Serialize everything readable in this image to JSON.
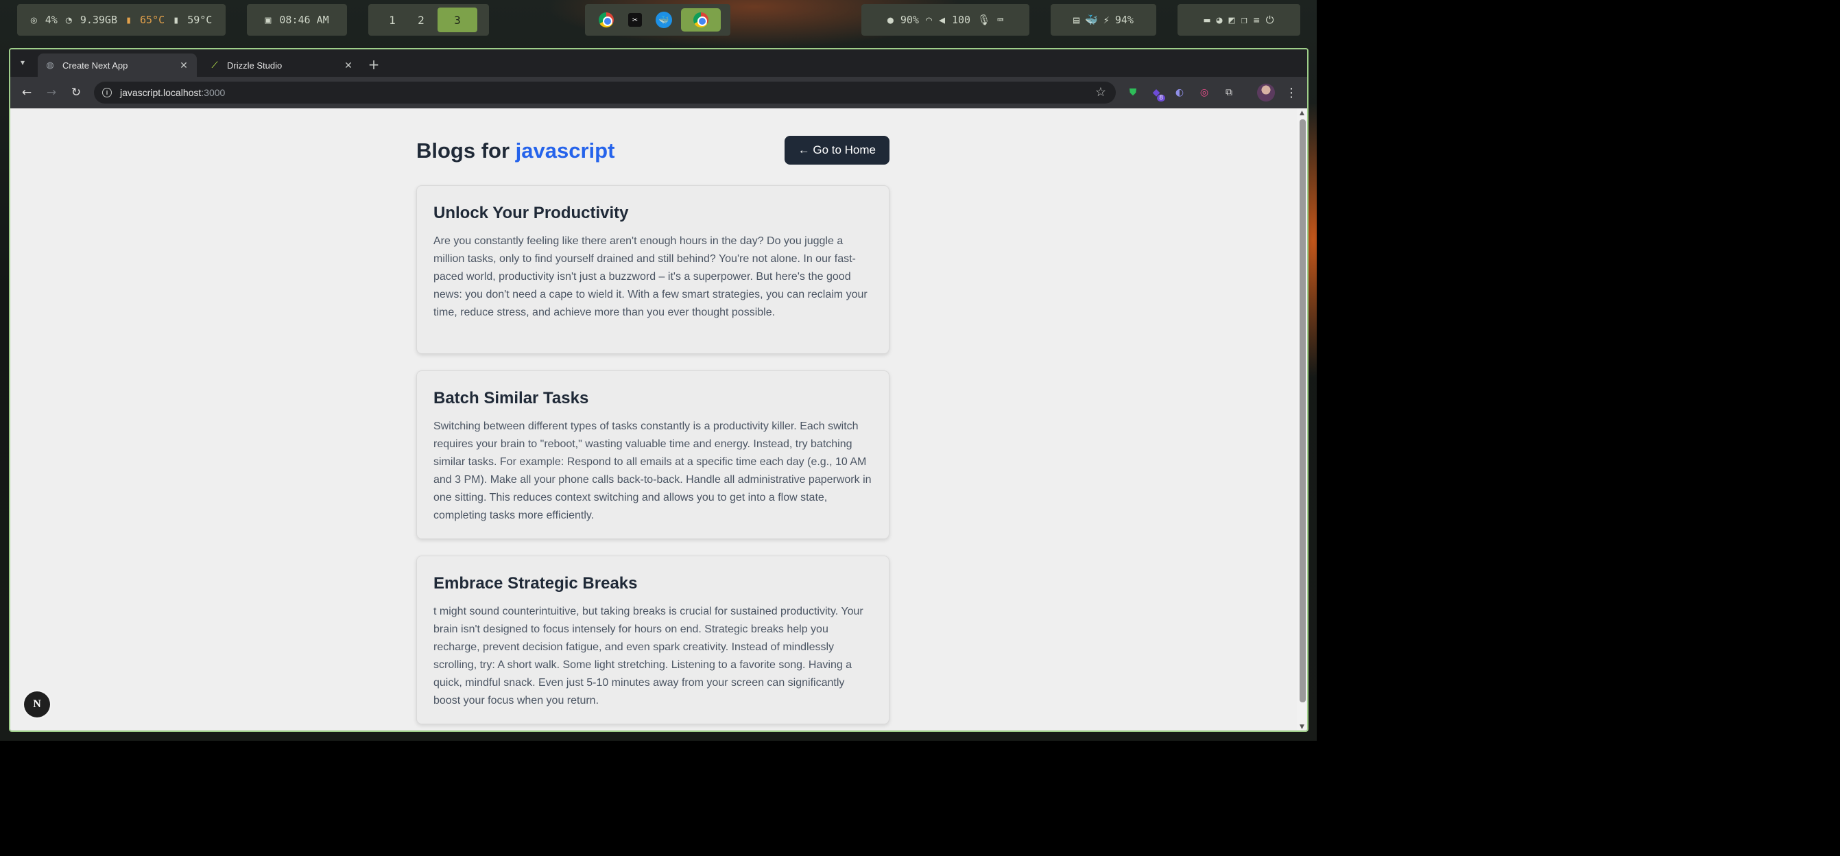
{
  "statusbar": {
    "cpu": "4%",
    "memory": "9.39GB",
    "cpu_temp": "65°C",
    "gpu_temp": "59°C",
    "clock": "08:46 AM",
    "workspaces": [
      "1",
      "2",
      "3"
    ],
    "active_workspace": "3",
    "brightness": "90%",
    "volume": "100",
    "battery": "94%"
  },
  "browser": {
    "tabs": [
      {
        "title": "Create Next App"
      },
      {
        "title": "Drizzle Studio"
      }
    ],
    "url_host": "javascript.localhost",
    "url_port": ":3000",
    "extension_badge": "8"
  },
  "page": {
    "title_prefix": "Blogs for ",
    "title_topic": "javascript",
    "home_button": "← Go to Home",
    "posts": [
      {
        "title": "Unlock Your Productivity",
        "body": "Are you constantly feeling like there aren't enough hours in the day? Do you juggle a million tasks, only to find yourself drained and still behind? You're not alone. In our fast-paced world, productivity isn't just a buzzword – it's a superpower. But here's the good news: you don't need a cape to wield it. With a few smart strategies, you can reclaim your time, reduce stress, and achieve more than you ever thought possible."
      },
      {
        "title": "Batch Similar Tasks",
        "body": "Switching between different types of tasks constantly is a productivity killer. Each switch requires your brain to \"reboot,\" wasting valuable time and energy. Instead, try batching similar tasks. For example: Respond to all emails at a specific time each day (e.g., 10 AM and 3 PM). Make all your phone calls back-to-back. Handle all administrative paperwork in one sitting. This reduces context switching and allows you to get into a flow state, completing tasks more efficiently."
      },
      {
        "title": "Embrace Strategic Breaks",
        "body": "t might sound counterintuitive, but taking breaks is crucial for sustained productivity. Your brain isn't designed to focus intensely for hours on end. Strategic breaks help you recharge, prevent decision fatigue, and even spark creativity. Instead of mindlessly scrolling, try: A short walk. Some light stretching. Listening to a favorite song. Having a quick, mindful snack. Even just 5-10 minutes away from your screen can significantly boost your focus when you return."
      }
    ],
    "next_badge": "N"
  }
}
